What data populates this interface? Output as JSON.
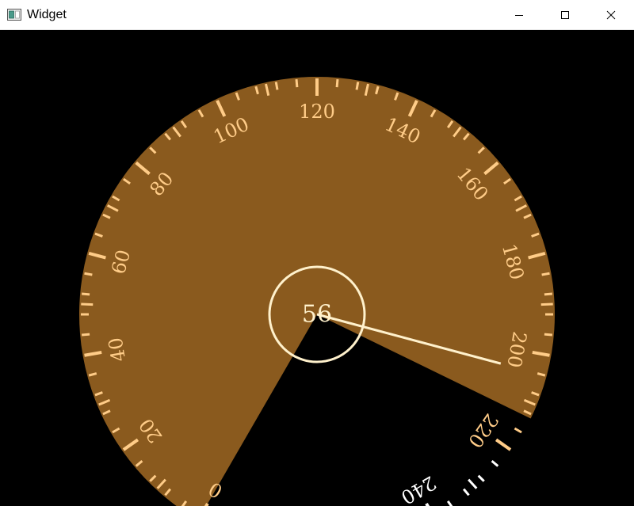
{
  "window": {
    "title": "Widget",
    "controls": {
      "minimize": "minimize-icon",
      "maximize": "maximize-icon",
      "close": "close-icon"
    }
  },
  "gauge": {
    "value": 56,
    "value_text": "56",
    "min": 0,
    "max": 240,
    "start_angle_deg": 240,
    "sweep_deg": 300,
    "minor_step": 4,
    "medium_step": 10,
    "major_step": 20,
    "scale_labels": [
      "0",
      "20",
      "40",
      "60",
      "80",
      "100",
      "120",
      "140",
      "160",
      "180",
      "200",
      "220",
      "240"
    ],
    "colors": {
      "background": "#000000",
      "active_fill": "#8a5a1e",
      "active_ticks": "#ffcc88",
      "inactive_ticks": "#ffffff",
      "inactive_labels": "#ffffff",
      "needle": "#fff1cc",
      "center_ring": "#fff1cc"
    }
  }
}
